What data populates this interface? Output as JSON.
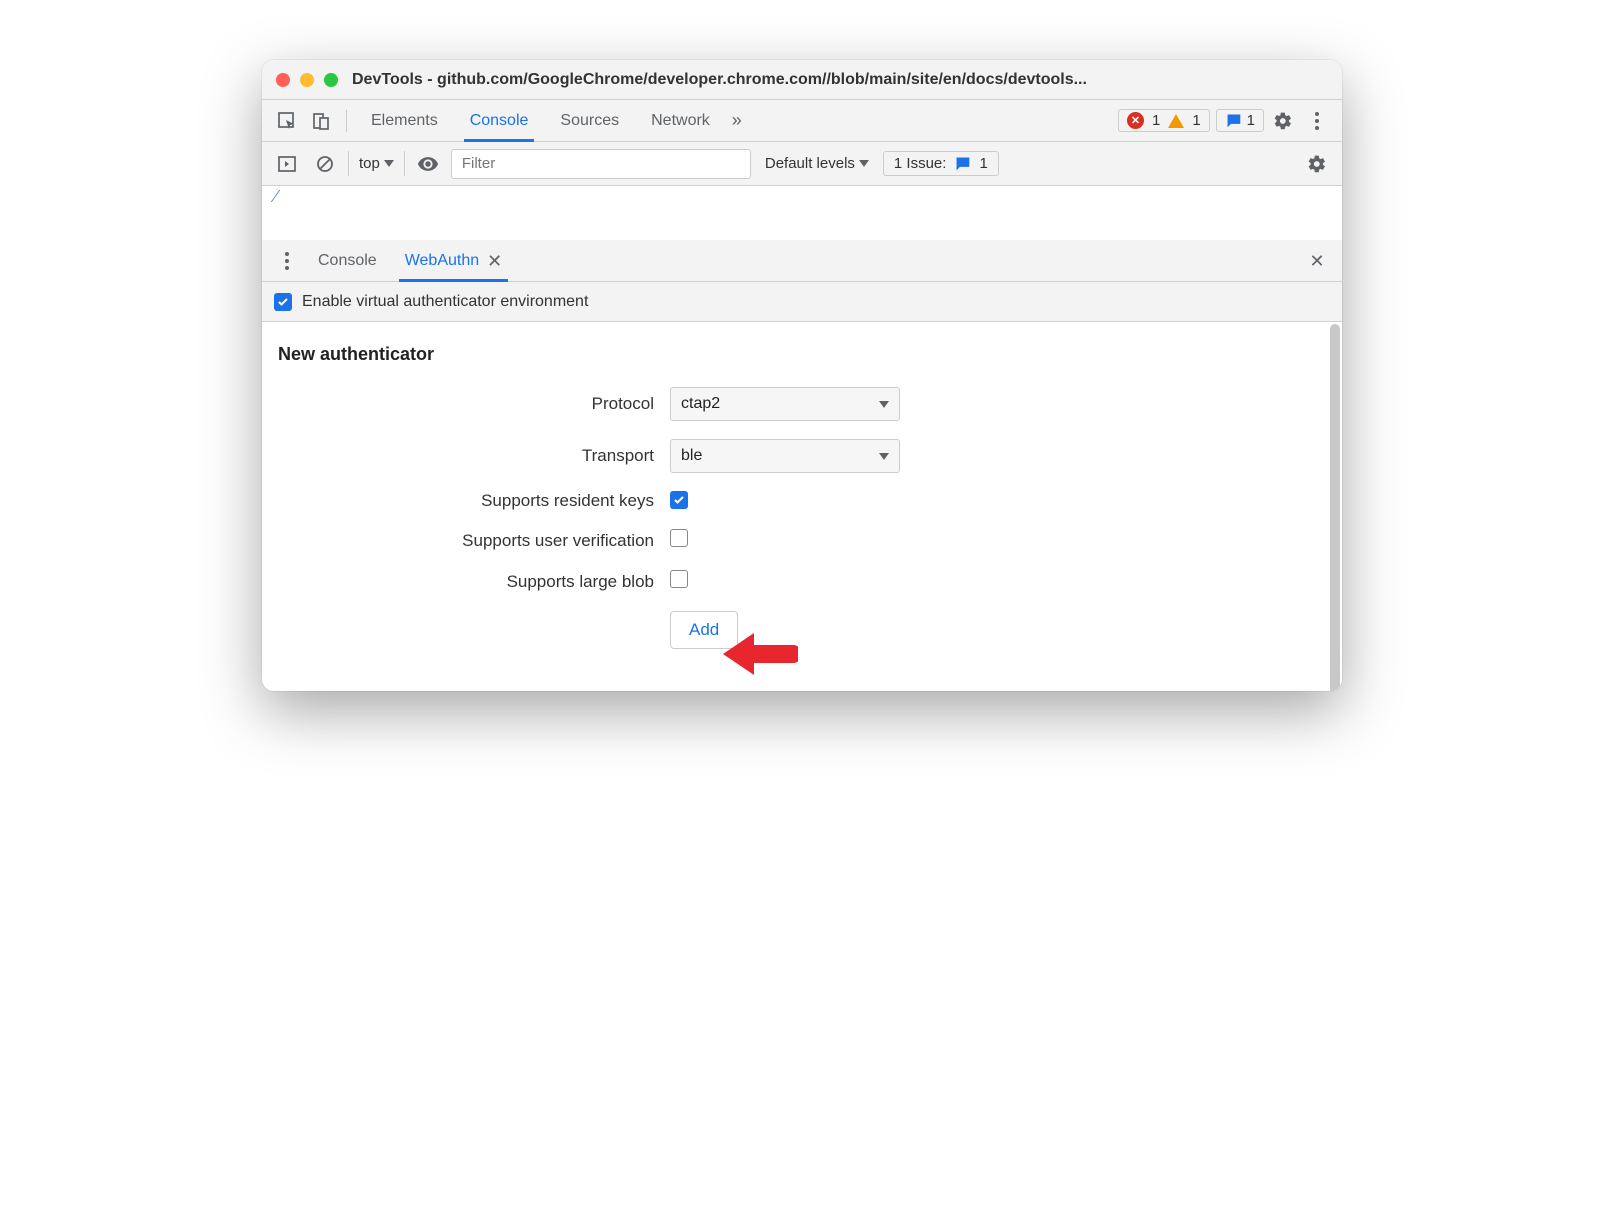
{
  "window": {
    "title": "DevTools - github.com/GoogleChrome/developer.chrome.com//blob/main/site/en/docs/devtools..."
  },
  "tabs": {
    "elements": "Elements",
    "console": "Console",
    "sources": "Sources",
    "network": "Network"
  },
  "badges": {
    "errors": "1",
    "warnings": "1",
    "messages": "1"
  },
  "consolebar": {
    "context": "top",
    "filter_placeholder": "Filter",
    "levels": "Default levels",
    "issues_label": "1 Issue:",
    "issues_count": "1"
  },
  "drawer": {
    "tabs": {
      "console": "Console",
      "webauthn": "WebAuthn"
    }
  },
  "enable": {
    "label": "Enable virtual authenticator environment",
    "checked": true
  },
  "form": {
    "title": "New authenticator",
    "protocol_label": "Protocol",
    "protocol_value": "ctap2",
    "transport_label": "Transport",
    "transport_value": "ble",
    "resident_label": "Supports resident keys",
    "resident_checked": true,
    "userver_label": "Supports user verification",
    "userver_checked": false,
    "largeblob_label": "Supports large blob",
    "largeblob_checked": false,
    "add_label": "Add"
  }
}
